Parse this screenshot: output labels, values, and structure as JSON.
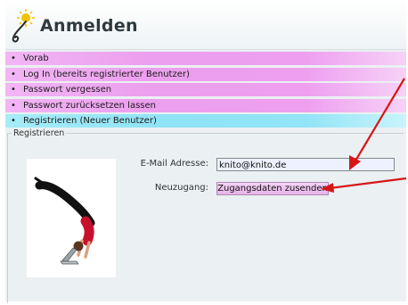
{
  "header": {
    "title": "Anmelden"
  },
  "menu": {
    "items": [
      {
        "label": "Vorab"
      },
      {
        "label": "Log In (bereits registrierter Benutzer)"
      },
      {
        "label": "Passwort vergessen"
      },
      {
        "label": "Passwort zurücksetzen lassen"
      },
      {
        "label": "Registrieren (Neuer Benutzer)"
      }
    ],
    "bullet": "•",
    "active_index": 4
  },
  "register": {
    "legend": "Registrieren",
    "email_label": "E-Mail Adresse:",
    "email_value": "knito@knito.de",
    "newaccess_label": "Neuzugang:",
    "submit_label": "Zugangsdaten zusenden"
  },
  "colors": {
    "menu_pink": "#ec9fee",
    "menu_active_cyan": "#8fe3f6",
    "arrow_red": "#d71616",
    "panel_bg": "#ebf0f2"
  },
  "icons": {
    "logo": "swirl-logo-icon"
  }
}
